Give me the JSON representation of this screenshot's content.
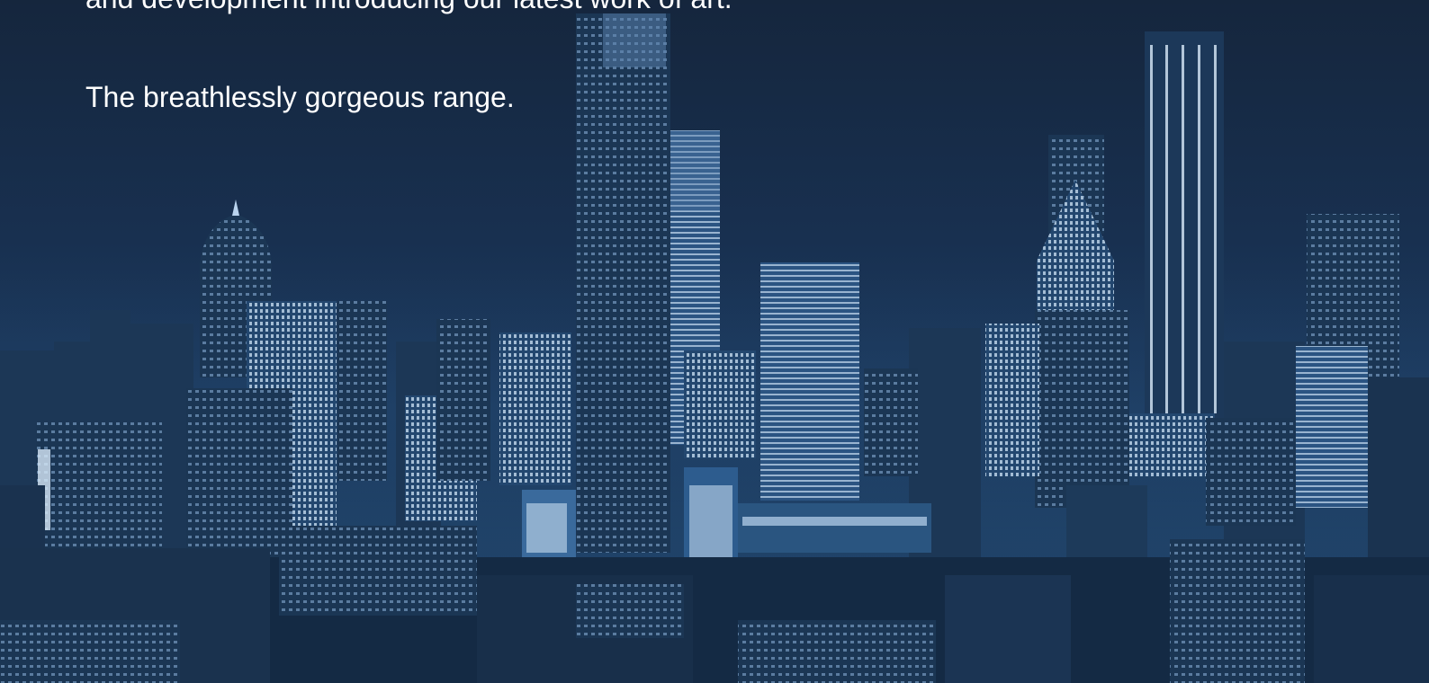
{
  "hero": {
    "intro_text": "and development introducing our latest work of art.",
    "tagline": "The breathlessly gorgeous range.",
    "background_image": "city-skyline-night"
  },
  "colors": {
    "sky_top": "#15263d",
    "sky_mid": "#1d3d62",
    "building": "#1a3553",
    "window_light": "#9fc4e8",
    "text": "#ffffff"
  }
}
